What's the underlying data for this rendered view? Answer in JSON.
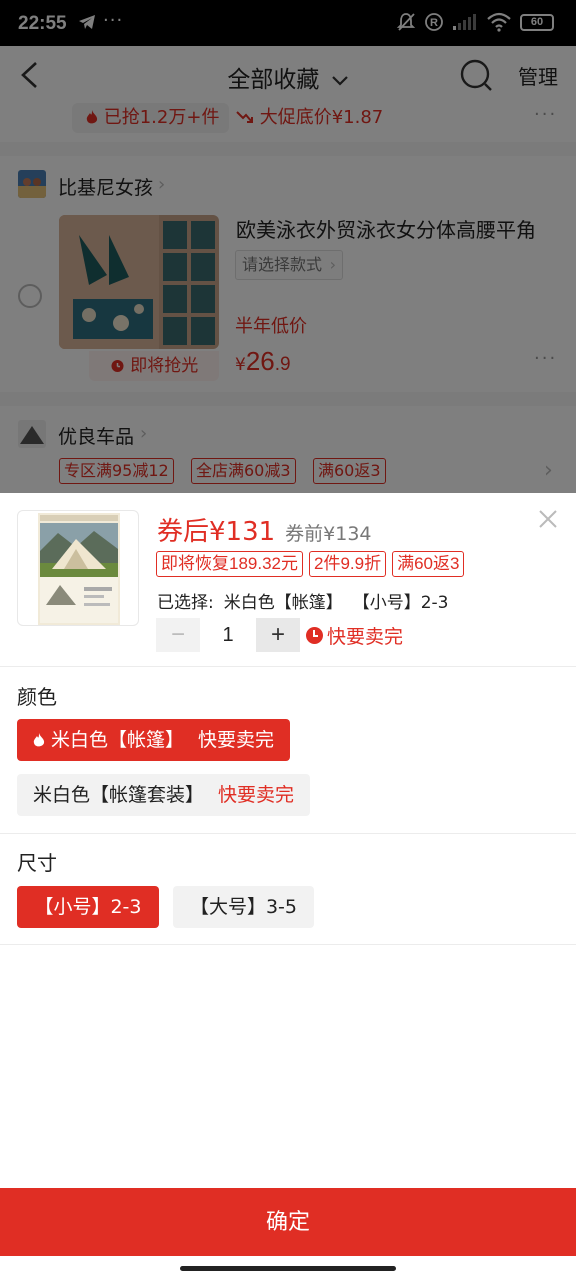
{
  "status_bar": {
    "time": "22:55",
    "more": "···",
    "battery": "60",
    "icons": [
      "telegram-icon",
      "mute-icon",
      "registered-icon",
      "signal-icon",
      "wifi-icon",
      "battery-icon"
    ]
  },
  "nav": {
    "title": "全部收藏",
    "manage": "管理"
  },
  "promo_row": {
    "sold": "已抢1.2万+件",
    "low_price": "大促底价¥1.87",
    "more": "···"
  },
  "shop1": {
    "name": "比基尼女孩",
    "product_title": "欧美泳衣外贸泳衣女分体高腰平角",
    "spec_placeholder": "请选择款式",
    "price_label": "半年低价",
    "price_currency": "¥",
    "price_int": "26",
    "price_dec": ".9",
    "badge": "即将抢光",
    "more": "···"
  },
  "shop2": {
    "name": "优良车品",
    "tags": [
      "专区满95减12",
      "全店满60减3",
      "满60返3"
    ]
  },
  "sheet": {
    "price_after": "券后¥131",
    "price_before": "券前¥134",
    "tags": [
      "即将恢复189.32元",
      "2件9.9折",
      "满60返3"
    ],
    "selected_label": "已选择:",
    "selected_color": "米白色【帐篷】",
    "selected_size": "【小号】2-3",
    "quantity": "1",
    "minus": "−",
    "plus": "+",
    "hot_note": "快要卖完",
    "color_label": "颜色",
    "colors": [
      {
        "name": "米白色【帐篷】",
        "note": "快要卖完"
      },
      {
        "name": "米白色【帐篷套装】",
        "note": "快要卖完"
      }
    ],
    "size_label": "尺寸",
    "sizes": [
      "【小号】2-3",
      "【大号】3-5"
    ],
    "confirm": "确定"
  },
  "colors": {
    "accent": "#e02e24",
    "overlay": "rgba(0,0,0,0.5)"
  }
}
